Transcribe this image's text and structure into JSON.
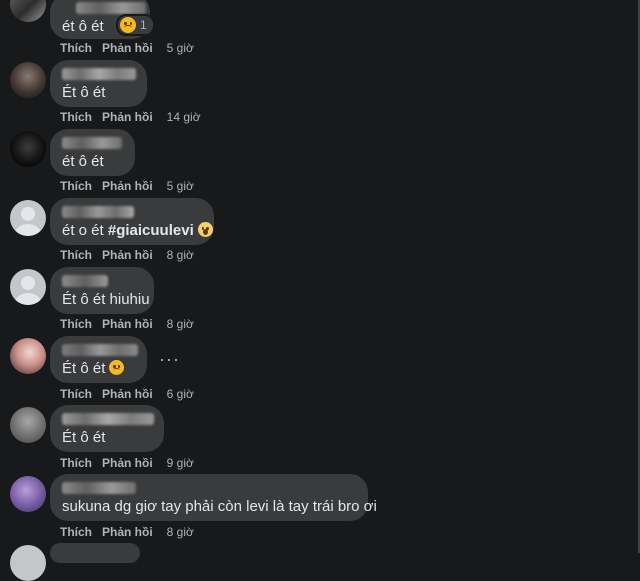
{
  "comments": [
    {
      "text": "ét ô ét",
      "actions": {
        "like": "Thích",
        "reply": "Phản hồi",
        "time": "5 giờ"
      },
      "reaction_count": "1"
    },
    {
      "text": "Ét ô ét",
      "actions": {
        "like": "Thích",
        "reply": "Phản hồi",
        "time": "14 giờ"
      }
    },
    {
      "text": "ét ô ét",
      "actions": {
        "like": "Thích",
        "reply": "Phản hồi",
        "time": "5 giờ"
      }
    },
    {
      "text": "ét o ét",
      "hashtag": "#giaicuulevi",
      "actions": {
        "like": "Thích",
        "reply": "Phản hồi",
        "time": "8 giờ"
      }
    },
    {
      "text": "Ét ô ét hiuhiu",
      "actions": {
        "like": "Thích",
        "reply": "Phản hồi",
        "time": "8 giờ"
      }
    },
    {
      "text": "Ét ô ét",
      "actions": {
        "like": "Thích",
        "reply": "Phản hồi",
        "time": "6 giờ"
      }
    },
    {
      "text": "Ét ô ét",
      "actions": {
        "like": "Thích",
        "reply": "Phản hồi",
        "time": "9 giờ"
      }
    },
    {
      "text": "sukuna dg giơ tay phải còn levi là tay trái bro ơi",
      "actions": {
        "like": "Thích",
        "reply": "Phản hồi",
        "time": "8 giờ"
      }
    }
  ],
  "icons": {
    "more": "more-options-icon",
    "reaction": "sad-face-icon",
    "emoji_scream": "scream-face-icon",
    "emoji_sad": "sad-face-icon"
  },
  "colors": {
    "background": "#18191a",
    "bubble": "#3a3b3c",
    "text": "#e4e6eb",
    "meta": "#b0b3b8"
  }
}
